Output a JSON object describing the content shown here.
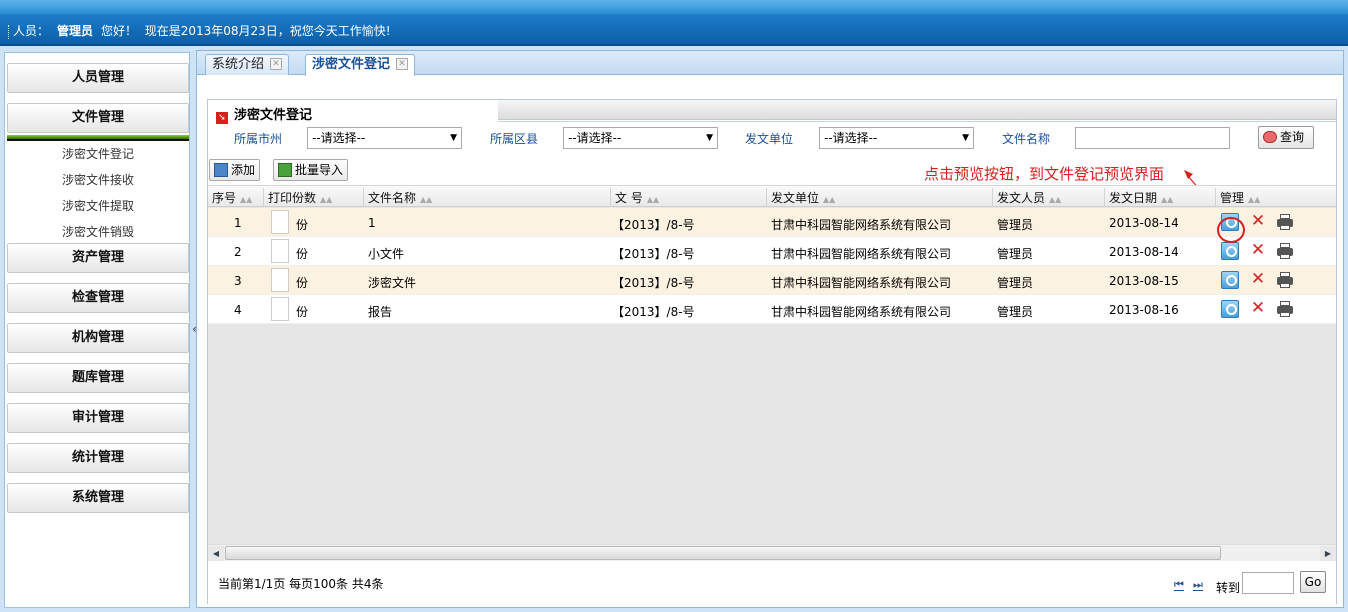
{
  "header": {
    "label": "人员：",
    "user": "管理员",
    "greeting": "您好！",
    "message": "现在是2013年08月23日，祝您今天工作愉快!"
  },
  "sidebar": {
    "items": [
      {
        "label": "人员管理"
      },
      {
        "label": "文件管理"
      },
      {
        "label": "资产管理"
      },
      {
        "label": "检查管理"
      },
      {
        "label": "机构管理"
      },
      {
        "label": "题库管理"
      },
      {
        "label": "审计管理"
      },
      {
        "label": "统计管理"
      },
      {
        "label": "系统管理"
      }
    ],
    "subitems": [
      {
        "label": "涉密文件登记"
      },
      {
        "label": "涉密文件接收"
      },
      {
        "label": "涉密文件提取"
      },
      {
        "label": "涉密文件销毁"
      }
    ],
    "collapse_glyph": "«"
  },
  "tabs": [
    {
      "label": "系统介绍"
    },
    {
      "label": "涉密文件登记"
    }
  ],
  "panel": {
    "title": "涉密文件登记"
  },
  "filters": {
    "city_label": "所属市州",
    "city_value": "--请选择--",
    "district_label": "所属区县",
    "district_value": "--请选择--",
    "issuer_label": "发文单位",
    "issuer_value": "--请选择--",
    "filename_label": "文件名称",
    "filename_value": "",
    "search_label": "查询"
  },
  "toolbar": {
    "add_label": "添加",
    "import_label": "批量导入"
  },
  "annotation": "点击预览按钮，到文件登记预览界面",
  "table": {
    "columns": [
      "序号",
      "打印份数",
      "文件名称",
      "文 号",
      "发文单位",
      "发文人员",
      "发文日期",
      "管理"
    ],
    "copies_unit": "份",
    "rows": [
      {
        "no": "1",
        "name": "1",
        "docno": "【2013】/8-号",
        "unit": "甘肃中科园智能网络系统有限公司",
        "person": "管理员",
        "date": "2013-08-14"
      },
      {
        "no": "2",
        "name": "小文件",
        "docno": "【2013】/8-号",
        "unit": "甘肃中科园智能网络系统有限公司",
        "person": "管理员",
        "date": "2013-08-14"
      },
      {
        "no": "3",
        "name": "涉密文件",
        "docno": "【2013】/8-号",
        "unit": "甘肃中科园智能网络系统有限公司",
        "person": "管理员",
        "date": "2013-08-15"
      },
      {
        "no": "4",
        "name": "报告",
        "docno": "【2013】/8-号",
        "unit": "甘肃中科园智能网络系统有限公司",
        "person": "管理员",
        "date": "2013-08-16"
      }
    ]
  },
  "pager": {
    "info": "当前第1/1页 每页100条 共4条",
    "first": "⏮",
    "last": "⏭",
    "goto_label": "转到",
    "go_label": "Go"
  },
  "colors": {
    "accent": "#1b78c4",
    "annotation": "#d81e1e",
    "alt_row": "#fbf2e2"
  }
}
